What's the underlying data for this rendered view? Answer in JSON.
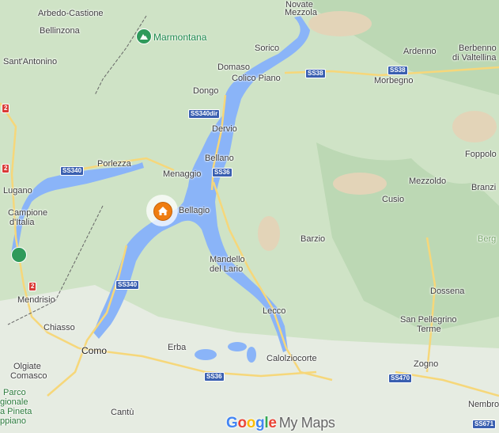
{
  "map": {
    "colors": {
      "land": "#cfe3c6",
      "water": "#8ab4f8",
      "road": "#f6d77a",
      "road_major": "#f2c14e",
      "border": "#555555",
      "marker": "#ef7d10"
    },
    "labels": {
      "arbedo": "Arbedo-Castione",
      "bellinzona": "Bellinzona",
      "sant_antonino": "Sant'Antonino",
      "novate": "Novate",
      "mezzola": "Mezzola",
      "sorico": "Sorico",
      "domaso": "Domaso",
      "colico": "Colico Piano",
      "dongo": "Dongo",
      "ardenno": "Ardenno",
      "berbenno1": "Berbenno",
      "berbenno2": "di Valtellina",
      "morbegno": "Morbegno",
      "dervio": "Dervio",
      "porlezza": "Porlezza",
      "bellano": "Bellano",
      "menaggio": "Menaggio",
      "lugano": "Lugano",
      "campione1": "Campione",
      "campione2": "d'Italia",
      "bellagio": "Bellagio",
      "barzio": "Barzio",
      "mezzoldo": "Mezzoldo",
      "cusio": "Cusio",
      "foppolo": "Foppolo",
      "branzi": "Branzi",
      "berg": "Berg",
      "mandello1": "Mandello",
      "mandello2": "del Lario",
      "mendrisio": "Mendrisio",
      "lecco": "Lecco",
      "chiasso": "Chiasso",
      "como": "Como",
      "erba": "Erba",
      "calolziocorte": "Calolziocorte",
      "olgiate1": "Olgiate",
      "olgiate2": "Comasco",
      "parco1": "Parco",
      "parco2": "gionale",
      "parco3": "a Pineta",
      "parco4": "ppiano",
      "cantu": "Cantù",
      "dossena": "Dossena",
      "sanpellegrino1": "San Pellegrino",
      "sanpellegrino2": "Terme",
      "zogno": "Zogno",
      "nembro": "Nembro"
    },
    "poi": {
      "marmontana": "Marmontana"
    },
    "shields": {
      "ss38a": "SS38",
      "ss38b": "SS38",
      "ss340dir": "SS340dir",
      "ss36a": "SS36",
      "ss340a": "SS340",
      "ss340b": "SS340",
      "ss36b": "SS36",
      "ss470": "SS470",
      "ss671": "SS671",
      "r2a": "2",
      "r2b": "2",
      "r2c": "2"
    },
    "attribution": {
      "google": "Google",
      "mymaps": "My Maps"
    }
  }
}
